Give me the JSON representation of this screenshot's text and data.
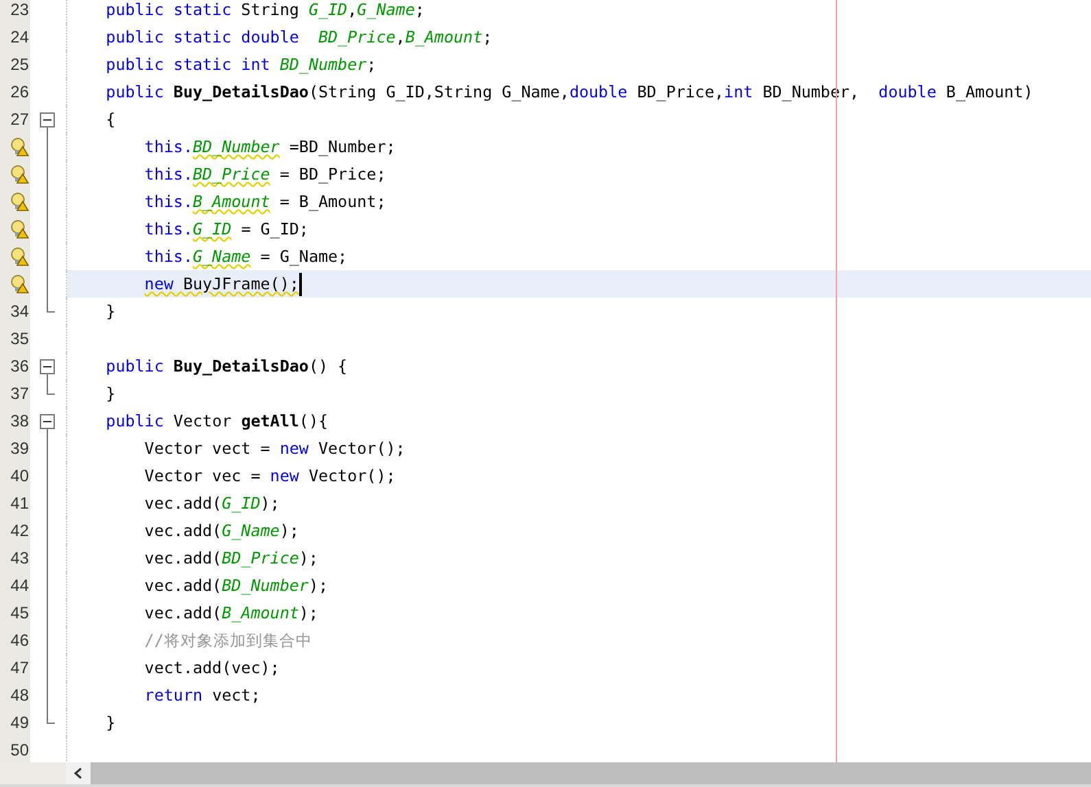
{
  "editor": {
    "lines": [
      {
        "number": "23",
        "kind": "plain",
        "tokens": [
          {
            "text": "    public static ",
            "kind": "keyword"
          },
          {
            "text": "String ",
            "kind": "plain"
          },
          {
            "text": "G_ID",
            "kind": "field"
          },
          {
            "text": ",",
            "kind": "plain"
          },
          {
            "text": "G_Name",
            "kind": "field"
          },
          {
            "text": ";",
            "kind": "plain"
          }
        ]
      },
      {
        "number": "24",
        "kind": "plain",
        "tokens": [
          {
            "text": "    public static double  ",
            "kind": "keyword"
          },
          {
            "text": "BD_Price",
            "kind": "field"
          },
          {
            "text": ",",
            "kind": "plain"
          },
          {
            "text": "B_Amount",
            "kind": "field"
          },
          {
            "text": ";",
            "kind": "plain"
          }
        ]
      },
      {
        "number": "25",
        "kind": "plain",
        "tokens": [
          {
            "text": "    public static int ",
            "kind": "keyword"
          },
          {
            "text": "BD_Number",
            "kind": "field"
          },
          {
            "text": ";",
            "kind": "plain"
          }
        ]
      },
      {
        "number": "26",
        "kind": "plain",
        "tokens": [
          {
            "text": "    public ",
            "kind": "keyword"
          },
          {
            "text": "Buy_DetailsDao",
            "kind": "method"
          },
          {
            "text": "(String G_ID,String G_Name,",
            "kind": "plain"
          },
          {
            "text": "double ",
            "kind": "keyword"
          },
          {
            "text": "BD_Price,",
            "kind": "plain"
          },
          {
            "text": "int ",
            "kind": "keyword"
          },
          {
            "text": "BD_Number,  ",
            "kind": "plain"
          },
          {
            "text": "double ",
            "kind": "keyword"
          },
          {
            "text": "B_Amount)",
            "kind": "plain"
          }
        ]
      },
      {
        "number": "27",
        "kind": "fold-start",
        "tokens": [
          {
            "text": "    {",
            "kind": "plain"
          }
        ]
      },
      {
        "kind": "fold-body",
        "warning": true,
        "tokens": [
          {
            "text": "        this.",
            "kind": "keyword"
          },
          {
            "text": "BD_Number",
            "kind": "field-warn"
          },
          {
            "text": " =BD_Number;",
            "kind": "plain"
          }
        ]
      },
      {
        "kind": "fold-body",
        "warning": true,
        "tokens": [
          {
            "text": "        this.",
            "kind": "keyword"
          },
          {
            "text": "BD_Price",
            "kind": "field-warn"
          },
          {
            "text": " = BD_Price;",
            "kind": "plain"
          }
        ]
      },
      {
        "kind": "fold-body",
        "warning": true,
        "tokens": [
          {
            "text": "        this.",
            "kind": "keyword"
          },
          {
            "text": "B_Amount",
            "kind": "field-warn"
          },
          {
            "text": " = B_Amount;",
            "kind": "plain"
          }
        ]
      },
      {
        "kind": "fold-body",
        "warning": true,
        "tokens": [
          {
            "text": "        this.",
            "kind": "keyword"
          },
          {
            "text": "G_ID",
            "kind": "field-warn"
          },
          {
            "text": " = G_ID;",
            "kind": "plain"
          }
        ]
      },
      {
        "kind": "fold-body",
        "warning": true,
        "tokens": [
          {
            "text": "        this.",
            "kind": "keyword"
          },
          {
            "text": "G_Name",
            "kind": "field-warn"
          },
          {
            "text": " = G_Name;",
            "kind": "plain"
          }
        ]
      },
      {
        "kind": "fold-body",
        "warning": true,
        "current": true,
        "tokens": [
          {
            "text": "        new ",
            "kind": "keyword-warn"
          },
          {
            "text": "BuyJFrame();",
            "kind": "plain-warn"
          }
        ]
      },
      {
        "number": "34",
        "kind": "fold-end",
        "tokens": [
          {
            "text": "    }",
            "kind": "plain"
          }
        ]
      },
      {
        "number": "35",
        "kind": "plain"
      },
      {
        "number": "36",
        "kind": "fold-start",
        "tokens": [
          {
            "text": "    public ",
            "kind": "keyword"
          },
          {
            "text": "Buy_DetailsDao",
            "kind": "method"
          },
          {
            "text": "() {",
            "kind": "plain"
          }
        ]
      },
      {
        "number": "37",
        "kind": "fold-end",
        "tokens": [
          {
            "text": "    }",
            "kind": "plain"
          }
        ]
      },
      {
        "number": "38",
        "kind": "fold-start",
        "tokens": [
          {
            "text": "    public ",
            "kind": "keyword"
          },
          {
            "text": "Vector ",
            "kind": "plain"
          },
          {
            "text": "getAll",
            "kind": "method"
          },
          {
            "text": "(){",
            "kind": "plain"
          }
        ]
      },
      {
        "number": "39",
        "kind": "fold-body",
        "tokens": [
          {
            "text": "        Vector vect = ",
            "kind": "plain"
          },
          {
            "text": "new ",
            "kind": "keyword"
          },
          {
            "text": "Vector();",
            "kind": "plain"
          }
        ]
      },
      {
        "number": "40",
        "kind": "fold-body",
        "tokens": [
          {
            "text": "        Vector vec = ",
            "kind": "plain"
          },
          {
            "text": "new ",
            "kind": "keyword"
          },
          {
            "text": "Vector();",
            "kind": "plain"
          }
        ]
      },
      {
        "number": "41",
        "kind": "fold-body",
        "tokens": [
          {
            "text": "        vec.add(",
            "kind": "plain"
          },
          {
            "text": "G_ID",
            "kind": "field"
          },
          {
            "text": ");",
            "kind": "plain"
          }
        ]
      },
      {
        "number": "42",
        "kind": "fold-body",
        "tokens": [
          {
            "text": "        vec.add(",
            "kind": "plain"
          },
          {
            "text": "G_Name",
            "kind": "field"
          },
          {
            "text": ");",
            "kind": "plain"
          }
        ]
      },
      {
        "number": "43",
        "kind": "fold-body",
        "tokens": [
          {
            "text": "        vec.add(",
            "kind": "plain"
          },
          {
            "text": "BD_Price",
            "kind": "field"
          },
          {
            "text": ");",
            "kind": "plain"
          }
        ]
      },
      {
        "number": "44",
        "kind": "fold-body",
        "tokens": [
          {
            "text": "        vec.add(",
            "kind": "plain"
          },
          {
            "text": "BD_Number",
            "kind": "field"
          },
          {
            "text": ");",
            "kind": "plain"
          }
        ]
      },
      {
        "number": "45",
        "kind": "fold-body",
        "tokens": [
          {
            "text": "        vec.add(",
            "kind": "plain"
          },
          {
            "text": "B_Amount",
            "kind": "field"
          },
          {
            "text": ");",
            "kind": "plain"
          }
        ]
      },
      {
        "number": "46",
        "kind": "fold-body",
        "tokens": [
          {
            "text": "        //将对象添加到集合中",
            "kind": "comment"
          }
        ]
      },
      {
        "number": "47",
        "kind": "fold-body",
        "tokens": [
          {
            "text": "        vect.add(vec);",
            "kind": "plain"
          }
        ]
      },
      {
        "number": "48",
        "kind": "fold-body",
        "tokens": [
          {
            "text": "        return ",
            "kind": "keyword"
          },
          {
            "text": "vect;",
            "kind": "plain"
          }
        ]
      },
      {
        "number": "49",
        "kind": "fold-end",
        "tokens": [
          {
            "text": "    }",
            "kind": "plain"
          }
        ]
      },
      {
        "number": "50",
        "kind": "plain"
      }
    ]
  }
}
